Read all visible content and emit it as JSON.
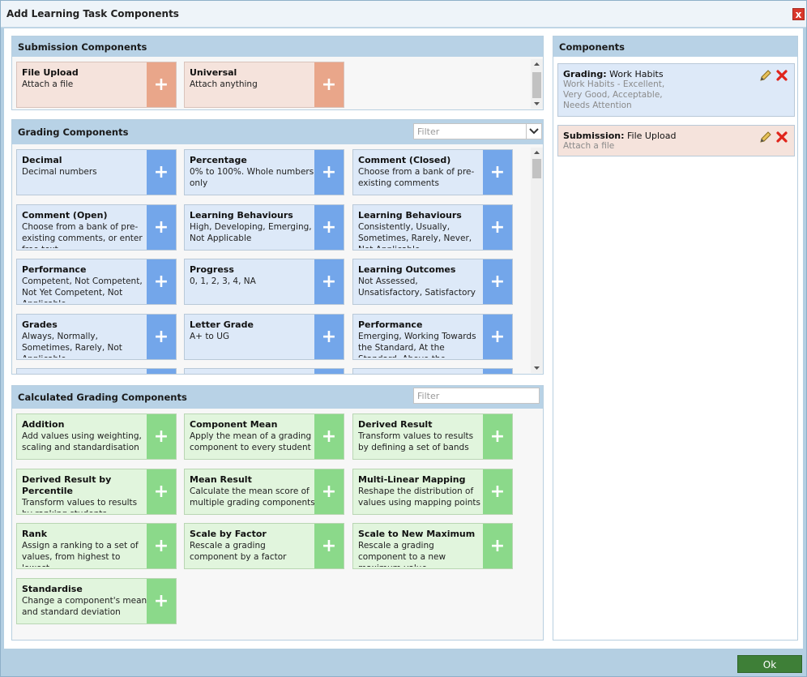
{
  "dialog": {
    "title": "Add Learning Task Components",
    "ok_label": "Ok"
  },
  "submission": {
    "title": "Submission Components",
    "items": [
      {
        "name": "File Upload",
        "desc": "Attach a file"
      },
      {
        "name": "Universal",
        "desc": "Attach anything"
      }
    ]
  },
  "grading": {
    "title": "Grading Components",
    "filter_placeholder": "Filter",
    "items": [
      {
        "name": "Decimal",
        "desc": "Decimal numbers"
      },
      {
        "name": "Percentage",
        "desc": "0% to 100%. Whole numbers only"
      },
      {
        "name": "Comment (Closed)",
        "desc": "Choose from a bank of pre-existing comments"
      },
      {
        "name": "Comment (Open)",
        "desc": "Choose from a bank of pre-existing comments, or enter free text"
      },
      {
        "name": "Learning Behaviours",
        "desc": "High, Developing, Emerging, Not Applicable"
      },
      {
        "name": "Learning Behaviours",
        "desc": "Consistently, Usually, Sometimes, Rarely, Never, Not Applicable"
      },
      {
        "name": "Performance",
        "desc": "Competent, Not Competent, Not Yet Competent, Not Applicable"
      },
      {
        "name": "Progress",
        "desc": "0, 1, 2, 3, 4, NA"
      },
      {
        "name": "Learning Outcomes",
        "desc": "Not Assessed, Unsatisfactory, Satisfactory"
      },
      {
        "name": "Grades",
        "desc": "Always, Normally, Sometimes, Rarely, Not Applicable"
      },
      {
        "name": "Letter Grade",
        "desc": "A+ to UG"
      },
      {
        "name": "Performance",
        "desc": "Emerging, Working Towards the Standard, At the Standard, Above the Standard, Well"
      }
    ]
  },
  "calculated": {
    "title": "Calculated Grading Components",
    "filter_placeholder": "Filter",
    "items": [
      {
        "name": "Addition",
        "desc": "Add values using weighting, scaling and standardisation"
      },
      {
        "name": "Component Mean",
        "desc": "Apply the mean of a grading component to every student"
      },
      {
        "name": "Derived Result",
        "desc": "Transform values to results by defining a set of bands"
      },
      {
        "name": "Derived Result by Percentile",
        "desc": "Transform values to results by ranking students"
      },
      {
        "name": "Mean Result",
        "desc": "Calculate the mean score of multiple grading components"
      },
      {
        "name": "Multi-Linear Mapping",
        "desc": "Reshape the distribution of values using mapping points"
      },
      {
        "name": "Rank",
        "desc": "Assign a ranking to a set of values, from highest to lowest"
      },
      {
        "name": "Scale by Factor",
        "desc": "Rescale a grading component by a factor"
      },
      {
        "name": "Scale to New Maximum",
        "desc": "Rescale a grading component to a new maximum value"
      },
      {
        "name": "Standardise",
        "desc": "Change a component's mean and standard deviation"
      }
    ]
  },
  "components": {
    "title": "Components",
    "items": [
      {
        "label": "Grading:",
        "value": "Work Habits",
        "desc": "Work Habits - Excellent, Very Good, Acceptable, Needs Attention"
      },
      {
        "label": "Submission:",
        "value": "File Upload",
        "desc": "Attach a file"
      }
    ]
  },
  "colors": {
    "submission_accent": "#e9a68a",
    "grading_accent": "#73a6ea",
    "calculated_accent": "#8bd98a",
    "ok_button": "#3e7f37",
    "delete_icon": "#d9382b"
  },
  "icons": {
    "add": "+",
    "close": "x",
    "edit": "pencil-icon",
    "delete": "delete-x-icon"
  }
}
